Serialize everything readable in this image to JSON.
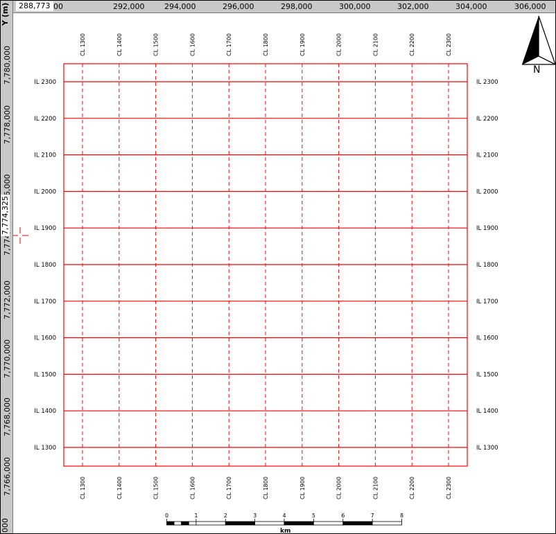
{
  "rulers": {
    "cursor_x": "288,773",
    "cursor_y": "7,774,325",
    "y_axis_title": "Y (m)",
    "bottom_corner_label": "000",
    "x_ticks": [
      "00",
      "292,000",
      "294,000",
      "296,000",
      "298,000",
      "300,000",
      "302,000",
      "304,000",
      "306,000"
    ],
    "y_ticks": [
      "7,780,000",
      "7,778,000",
      "76,000",
      "7,774,0",
      "7,772,000",
      "7,770,000",
      "7,768,000",
      "7,766,000"
    ]
  },
  "grid": {
    "color": "#ff0000",
    "crosslines": [
      "CL 1300",
      "CL 1400",
      "CL 1500",
      "CL 1600",
      "CL 1700",
      "CL 1800",
      "CL 1900",
      "CL 2000",
      "CL 2100",
      "CL 2200",
      "CL 2300"
    ],
    "inlines": [
      "IL 2300",
      "IL 2200",
      "IL 2100",
      "IL 2000",
      "IL 1900",
      "IL 1800",
      "IL 1700",
      "IL 1600",
      "IL 1500",
      "IL 1400",
      "IL 1300"
    ]
  },
  "north_arrow": {
    "label": "N",
    "icon": "north-arrow-icon"
  },
  "scale_bar": {
    "ticks": [
      "0",
      "1",
      "2",
      "3",
      "4",
      "5",
      "6",
      "7",
      "8"
    ],
    "unit": "km"
  },
  "cursor": {
    "icon": "crosshair-icon",
    "color": "#ff0000"
  }
}
